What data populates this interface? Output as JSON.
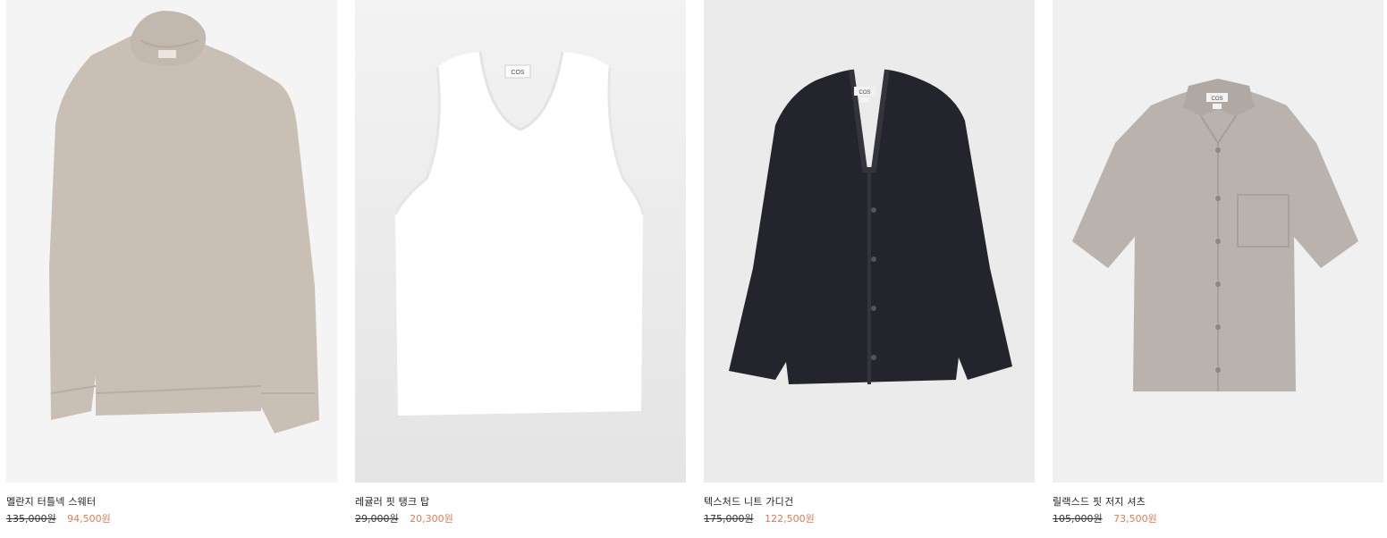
{
  "products": [
    {
      "name": "멜란지 터틀넥 스웨터",
      "original_price": "135,000원",
      "sale_price": "94,500원",
      "image": "turtleneck-sweater",
      "background": "#f4f4f4",
      "garment_color": "#c8beb4"
    },
    {
      "name": "레귤러 핏 탱크 탑",
      "original_price": "29,000원",
      "sale_price": "20,300원",
      "image": "tank-top",
      "background": "#ececec",
      "garment_color": "#ffffff"
    },
    {
      "name": "텍스처드 니트 가디건",
      "original_price": "175,000원",
      "sale_price": "122,500원",
      "image": "cardigan",
      "background": "#ebebeb",
      "garment_color": "#23242b"
    },
    {
      "name": "릴랙스드 핏 저지 셔츠",
      "original_price": "105,000원",
      "sale_price": "73,500원",
      "image": "jersey-shirt",
      "background": "#f0f0f0",
      "garment_color": "#b9b2ac"
    }
  ],
  "label_text": "COS",
  "colors": {
    "sale": "#e07b53",
    "strike": "#333333"
  }
}
